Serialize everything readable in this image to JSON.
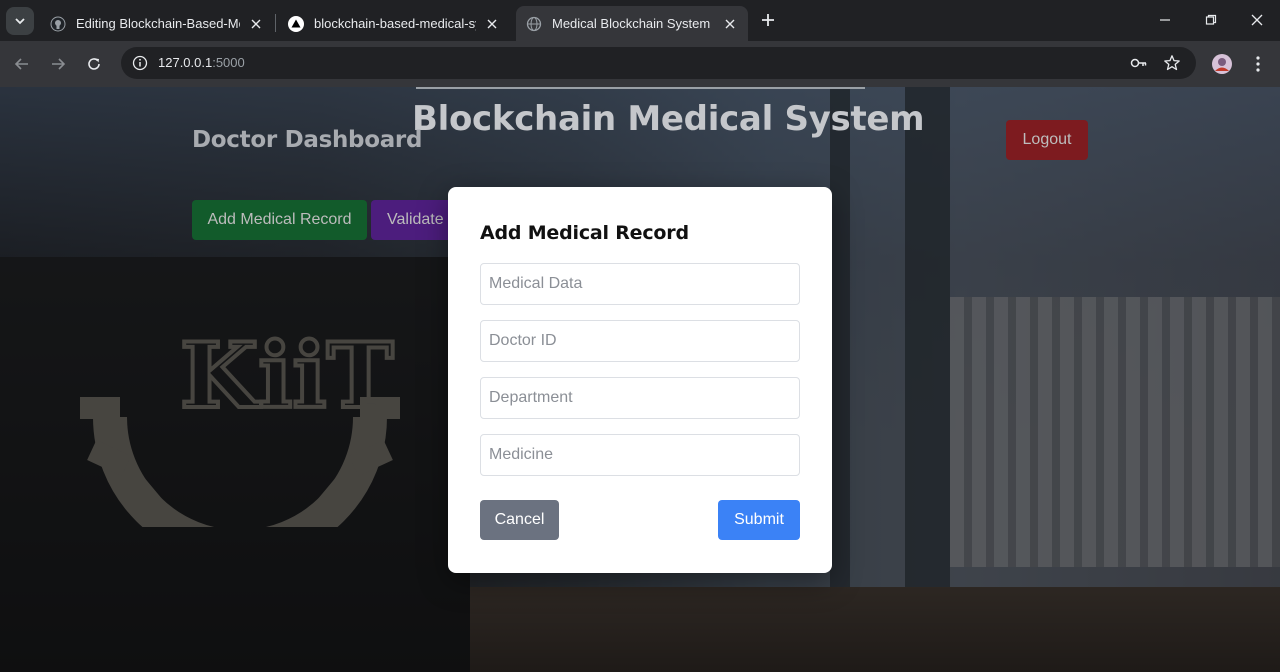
{
  "browser": {
    "tabs": [
      {
        "title": "Editing Blockchain-Based-Medi",
        "favicon": "github-icon",
        "active": false
      },
      {
        "title": "blockchain-based-medical-syste",
        "favicon": "vercel-icon",
        "active": false
      },
      {
        "title": "Medical Blockchain System",
        "favicon": "globe-icon",
        "active": true
      }
    ],
    "url_host": "127.0.0.1",
    "url_port": ":5000"
  },
  "page": {
    "title": "Blockchain Medical System",
    "dashboard_heading": "Doctor Dashboard",
    "logout_label": "Logout",
    "add_record_label": "Add Medical Record",
    "validate_label": "Validate",
    "colors": {
      "logout": "#dc3545",
      "add": "#28a745",
      "validate": "#6f42c1"
    }
  },
  "modal": {
    "title": "Add Medical Record",
    "fields": [
      {
        "placeholder": "Medical Data",
        "value": ""
      },
      {
        "placeholder": "Doctor ID",
        "value": ""
      },
      {
        "placeholder": "Department",
        "value": ""
      },
      {
        "placeholder": "Medicine",
        "value": ""
      }
    ],
    "cancel_label": "Cancel",
    "submit_label": "Submit",
    "colors": {
      "cancel": "#6b7280",
      "submit": "#3b82f6"
    }
  }
}
